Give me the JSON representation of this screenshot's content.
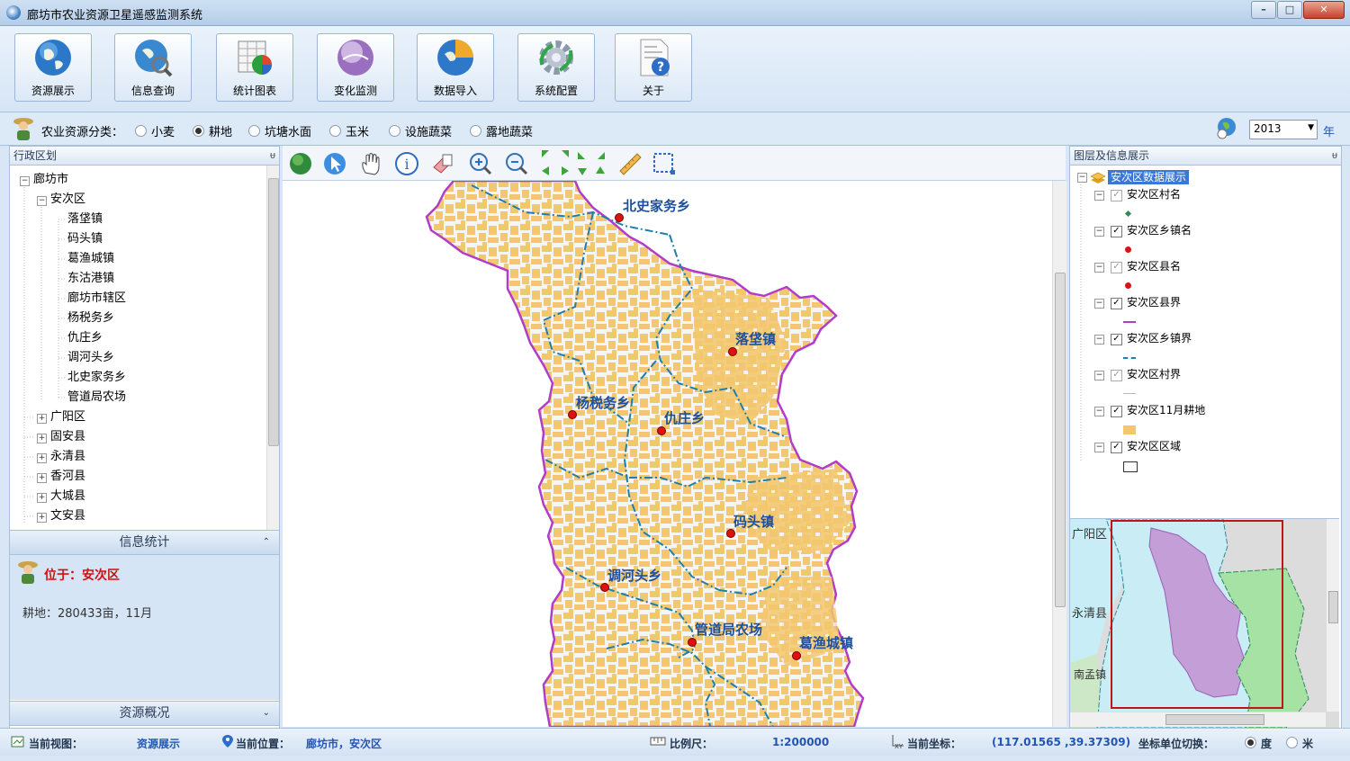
{
  "window": {
    "title": "廊坊市农业资源卫星遥感监测系统",
    "controls": {
      "minimize": "–",
      "maximize": "□",
      "close": "✕"
    }
  },
  "toolbar": {
    "buttons": [
      {
        "label": "资源展示",
        "icon": "globe-icon"
      },
      {
        "label": "信息查询",
        "icon": "globe-search-icon"
      },
      {
        "label": "统计图表",
        "icon": "chart-icon"
      },
      {
        "label": "变化监测",
        "icon": "monitor-orb-icon"
      },
      {
        "label": "数据导入",
        "icon": "data-import-icon"
      },
      {
        "label": "系统配置",
        "icon": "gear-icon"
      },
      {
        "label": "关于",
        "icon": "help-doc-icon"
      }
    ]
  },
  "category": {
    "label": "农业资源分类：",
    "options": [
      "小麦",
      "耕地",
      "坑塘水面",
      "玉米",
      "设施蔬菜",
      "露地蔬菜"
    ],
    "selected": "耕地",
    "year_value": "2013",
    "year_unit": "年"
  },
  "left_panel": {
    "title": "行政区划",
    "pin": "ᵾ",
    "tree": {
      "root": "廊坊市",
      "expanded": "安次区",
      "towns": [
        "落垡镇",
        "码头镇",
        "葛渔城镇",
        "东沽港镇",
        "廊坊市辖区",
        "杨税务乡",
        "仇庄乡",
        "调河头乡",
        "北史家务乡",
        "管道局农场"
      ],
      "others": [
        "广阳区",
        "固安县",
        "永清县",
        "香河县",
        "大城县",
        "文安县"
      ]
    },
    "info_section": {
      "title": "信息统计",
      "location_prefix": "位于：",
      "location_value": "安次区",
      "stat_text": "耕地：280433亩，11月"
    },
    "overview_section": {
      "title": "资源概况"
    }
  },
  "map": {
    "tools": [
      "globe-icon",
      "pointer-icon",
      "pan-hand-icon",
      "info-icon",
      "eraser-icon",
      "zoom-in-icon",
      "zoom-out-icon",
      "arrow-nw-icon",
      "arrow-ne-icon",
      "arrow-sw-icon",
      "arrow-se-icon",
      "arrow-w-icon",
      "arrow-e-icon",
      "arrow-down-icon",
      "arrow-up-icon",
      "ruler-icon",
      "select-box-icon"
    ],
    "labels": [
      "北史家务乡",
      "落垡镇",
      "杨税务乡",
      "仇庄乡",
      "码头镇",
      "调河头乡",
      "管道局农场",
      "葛渔城镇"
    ],
    "colors": {
      "farmland": "#f3c76f",
      "county_boundary": "#b23cc8",
      "town_boundary": "#1f7fa8",
      "label": "#1d4f9c",
      "point": "#dd1111"
    }
  },
  "right_panel": {
    "title": "图层及信息展示",
    "root_layer": "安次区数据展示",
    "layers": [
      {
        "name": "安次区村名",
        "checked": "gray"
      },
      {
        "name": "安次区乡镇名",
        "checked": "yes"
      },
      {
        "name": "安次区县名",
        "checked": "gray"
      },
      {
        "name": "安次区县界",
        "checked": "yes"
      },
      {
        "name": "安次区乡镇界",
        "checked": "yes"
      },
      {
        "name": "安次区村界",
        "checked": "gray"
      },
      {
        "name": "安次区11月耕地",
        "checked": "yes"
      },
      {
        "name": "安次区区域",
        "checked": "yes"
      }
    ],
    "overview_labels": [
      "广阳区",
      "永清县",
      "南孟镇"
    ]
  },
  "status": {
    "view_label": "当前视图：",
    "view_value": "资源展示",
    "pos_label": "当前位置：",
    "pos_value": "廊坊市，安次区",
    "scale_label": "比例尺：",
    "scale_value": "1:200000",
    "coord_label": "当前坐标：",
    "coord_value": "(117.01565 ,39.37309)",
    "unit_label": "坐标单位切换：",
    "unit_options": [
      "度",
      "米"
    ],
    "unit_selected": "度"
  }
}
